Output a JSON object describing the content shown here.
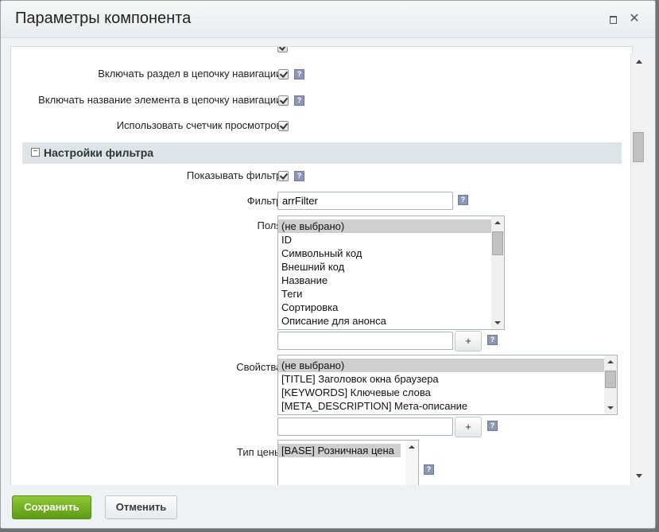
{
  "dialog": {
    "title": "Параметры компонента",
    "maximize_icon": "maximize-icon",
    "close_icon": "close-icon",
    "close_glyph": "✕"
  },
  "rows": {
    "include_section_nav": {
      "label": "Включать раздел в цепочку навигации:",
      "checked": true
    },
    "include_element_nav": {
      "label": "Включать название элемента в цепочку навигации:",
      "checked": true
    },
    "use_view_counter": {
      "label": "Использовать счетчик просмотров:",
      "checked": true
    }
  },
  "help_glyph": "?",
  "filter_section": {
    "title": "Настройки фильтра",
    "toggle_glyph": "−",
    "show_filter": {
      "label": "Показывать фильтр:",
      "checked": true
    },
    "filter": {
      "label": "Фильтр:",
      "value": "arrFilter"
    },
    "fields": {
      "label": "Поля:",
      "options": [
        "(не выбрано)",
        "ID",
        "Символьный код",
        "Внешний код",
        "Название",
        "Теги",
        "Сортировка",
        "Описание для анонса"
      ],
      "selected_index": 0,
      "add_glyph": "+"
    },
    "properties": {
      "label": "Свойства:",
      "options": [
        "(не выбрано)",
        "[TITLE] Заголовок окна браузера",
        "[KEYWORDS] Ключевые слова",
        "[META_DESCRIPTION] Мета-описание"
      ],
      "selected_index": 0,
      "add_glyph": "+"
    },
    "price_type": {
      "label": "Тип цены:",
      "options": [
        "[BASE] Розничная цена"
      ],
      "selected_index": 0
    }
  },
  "footer": {
    "save_label": "Сохранить",
    "cancel_label": "Отменить",
    "save_color": "#6aa61d"
  }
}
